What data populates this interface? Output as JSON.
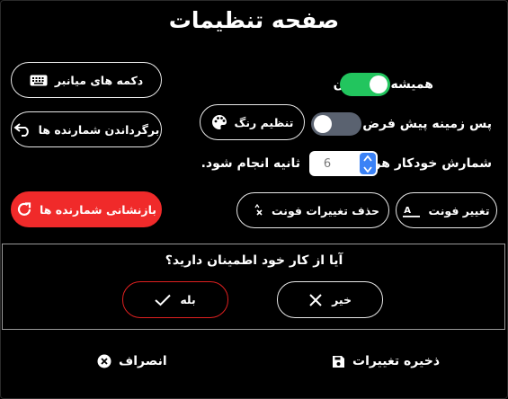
{
  "dialog": {
    "title": "صفحه تنظیمات"
  },
  "settings": {
    "always_on_top": {
      "label": "همیشه بالا بودن",
      "enabled": true
    },
    "default_background": {
      "label": "پس زمینه پیش فرض",
      "enabled": false
    },
    "set_color": {
      "label": "تنظیم رنگ"
    },
    "autocount": {
      "label_before": "شمارش خودکار هر",
      "value": "6",
      "label_after": "ثانیه انجام شود."
    },
    "change_font": {
      "label": "تغییر فونت"
    },
    "remove_font_changes": {
      "label": "حذف تغییرات فونت"
    }
  },
  "side_buttons": {
    "shortcut_keys": {
      "label": "دکمه های میانبر"
    },
    "restore_counters": {
      "label": "برگرداندن شمارنده ها"
    },
    "reset_counters": {
      "label": "بازنشانی شمارنده ها",
      "color": "#f02a2a"
    }
  },
  "confirm": {
    "question": "آیا از کار خود اطمینان دارید؟",
    "yes": {
      "label": "بله"
    },
    "no": {
      "label": "خیر"
    }
  },
  "footer": {
    "save": {
      "label": "ذخیره تغییرات"
    },
    "cancel": {
      "label": "انصراف"
    }
  },
  "colors": {
    "toggle_on": "#22c55e",
    "toggle_off": "#5a6270",
    "accent": "#3b82f6",
    "danger": "#f02a2a"
  },
  "icons": [
    "keyboard-icon",
    "undo-arrow-icon",
    "refresh-icon",
    "palette-icon",
    "font-size-icon",
    "clear-format-icon",
    "check-icon",
    "close-x-icon",
    "floppy-disk-icon",
    "circle-x-icon"
  ]
}
